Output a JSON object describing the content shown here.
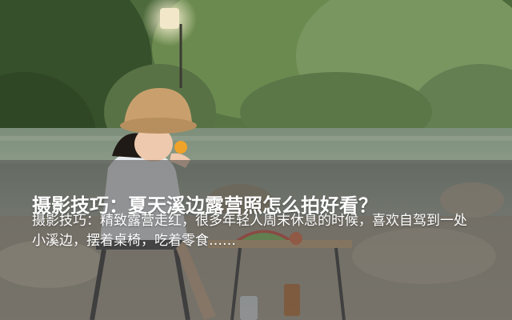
{
  "article": {
    "title": "摄影技巧：夏天溪边露营照怎么拍好看？",
    "excerpt": "摄影技巧：精致露营走红，很多年轻人周末休息的时候，喜欢自驾到一处小溪边，摆着桌椅，吃着零食……"
  },
  "colors": {
    "overlay": "#4a4a4a",
    "text": "#ffffff",
    "foliage": "#3f5a32",
    "water": "#8a9a86"
  }
}
